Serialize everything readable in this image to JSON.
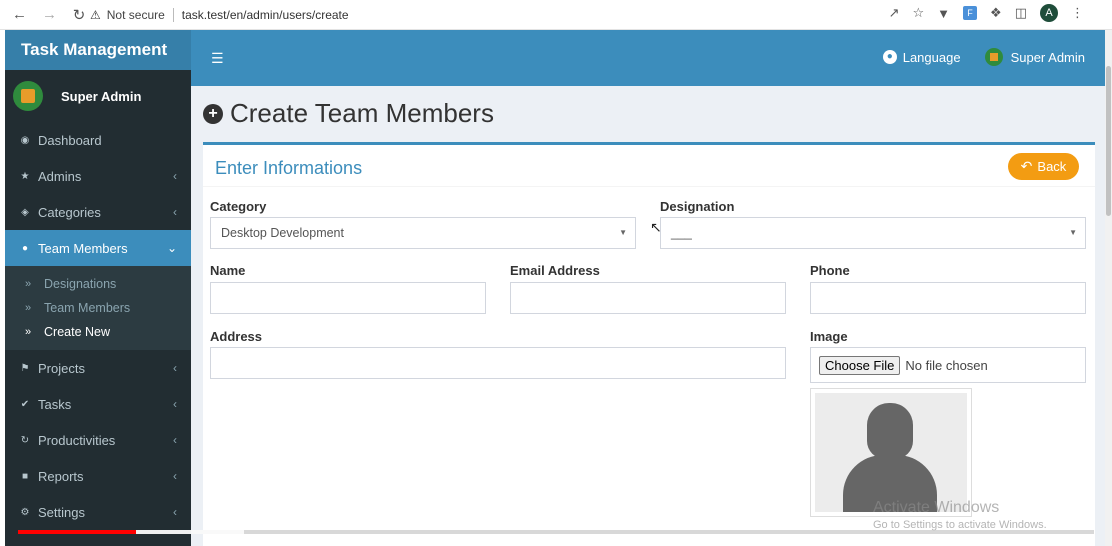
{
  "browser": {
    "security": "Not secure",
    "url": "task.test/en/admin/users/create",
    "profile_initial": "A",
    "ext_label": "F"
  },
  "sidebar": {
    "brand": "Task Management",
    "user_name": "Super Admin",
    "items": [
      {
        "label": "Dashboard",
        "icon": "dashboard-icon"
      },
      {
        "label": "Admins",
        "icon": "star-icon"
      },
      {
        "label": "Categories",
        "icon": "tags-icon"
      },
      {
        "label": "Team Members",
        "icon": "users-icon"
      },
      {
        "label": "Projects",
        "icon": "flag-icon"
      },
      {
        "label": "Tasks",
        "icon": "check-circle-icon"
      },
      {
        "label": "Productivities",
        "icon": "refresh-icon"
      },
      {
        "label": "Reports",
        "icon": "folder-icon"
      },
      {
        "label": "Settings",
        "icon": "cogs-icon"
      }
    ],
    "submenu": [
      {
        "label": "Designations"
      },
      {
        "label": "Team Members"
      },
      {
        "label": "Create New"
      }
    ]
  },
  "topbar": {
    "language": "Language",
    "user": "Super Admin"
  },
  "page": {
    "title": "Create Team Members",
    "box_title": "Enter Informations",
    "back_label": "Back"
  },
  "form": {
    "category_label": "Category",
    "category_value": "Desktop Development",
    "designation_label": "Designation",
    "designation_value": "___",
    "name_label": "Name",
    "email_label": "Email Address",
    "phone_label": "Phone",
    "address_label": "Address",
    "image_label": "Image",
    "choose_file": "Choose File",
    "no_file": "No file chosen"
  },
  "watermark": {
    "line1": "Activate Windows",
    "line2": "Go to Settings to activate Windows."
  },
  "video": {
    "progress_fraction": 0.11,
    "buffer_fraction": 0.21
  },
  "colors": {
    "sidebar": "#222d32",
    "primary": "#3c8dbc",
    "warning": "#f39c12"
  }
}
